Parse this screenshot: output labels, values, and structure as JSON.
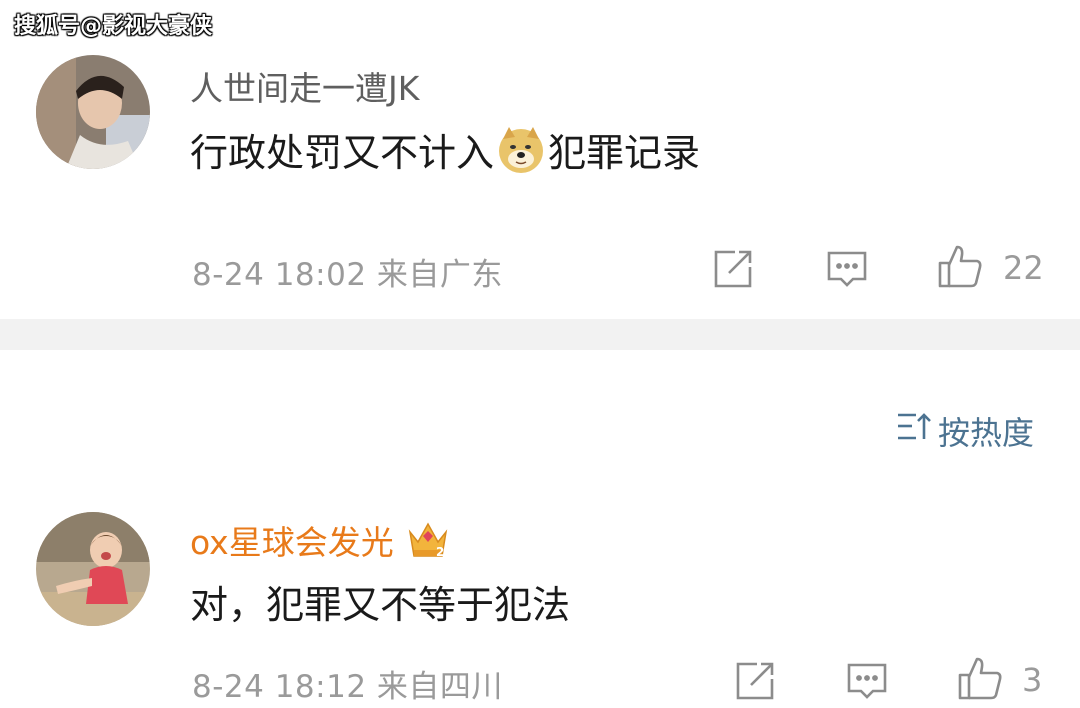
{
  "watermark": "搜狐号@影视大豪侠",
  "comments": [
    {
      "username": "人世间走一遭JK",
      "text_before": "行政处罚又不计入",
      "emoji": "doge-emoji",
      "text_after": "犯罪记录",
      "meta": "8-24 18:02 来自广东",
      "likes": "22"
    },
    {
      "username": "ox星球会发光",
      "badge": "crown-badge-icon",
      "text": "对，犯罪又不等于犯法",
      "meta": "8-24 18:12 来自四川",
      "likes": "3"
    }
  ],
  "sort": {
    "label": "按热度",
    "icon": "sort-icon"
  },
  "colors": {
    "username_default": "#5f5f5f",
    "username_vip": "#e87a1a",
    "meta": "#9a9a9a",
    "sort": "#4c7391",
    "divider": "#f2f2f2"
  }
}
